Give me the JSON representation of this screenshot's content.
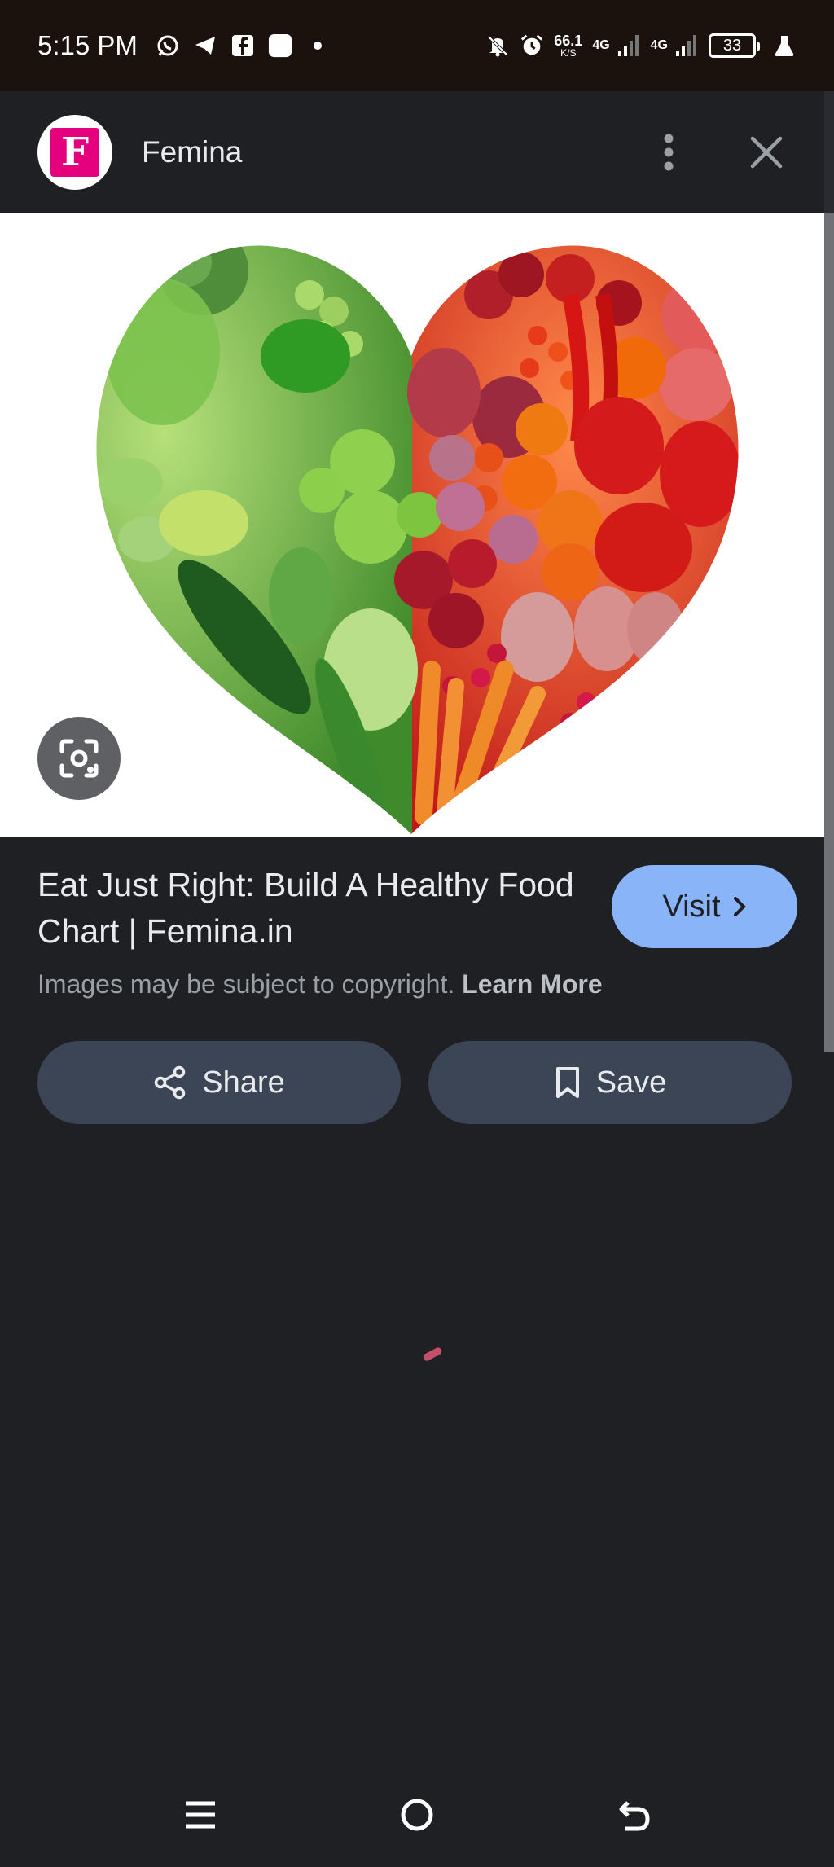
{
  "status_bar": {
    "time": "5:15 PM",
    "left_icons": [
      "whatsapp-icon",
      "telegram-icon",
      "facebook-icon",
      "app-icon",
      "dot-icon"
    ],
    "net_speed_value": "66.1",
    "net_speed_unit": "K/S",
    "sim1_label": "4G",
    "sim2_label": "4G",
    "battery": "33"
  },
  "header": {
    "source_logo_letter": "F",
    "source_name": "Femina"
  },
  "image": {
    "description_icon": "lens-icon"
  },
  "result": {
    "title": "Eat Just Right: Build A Healthy Food Chart | Femina.in",
    "visit_label": "Visit",
    "copyright_text": "Images may be subject to copyright.",
    "learn_more_label": "Learn More",
    "share_label": "Share",
    "save_label": "Save"
  },
  "colors": {
    "background": "#1f2024",
    "status_bar": "#1b120d",
    "visit_button": "#8ab4f8",
    "action_button": "#3c4555",
    "femina_brand": "#e5007e"
  }
}
